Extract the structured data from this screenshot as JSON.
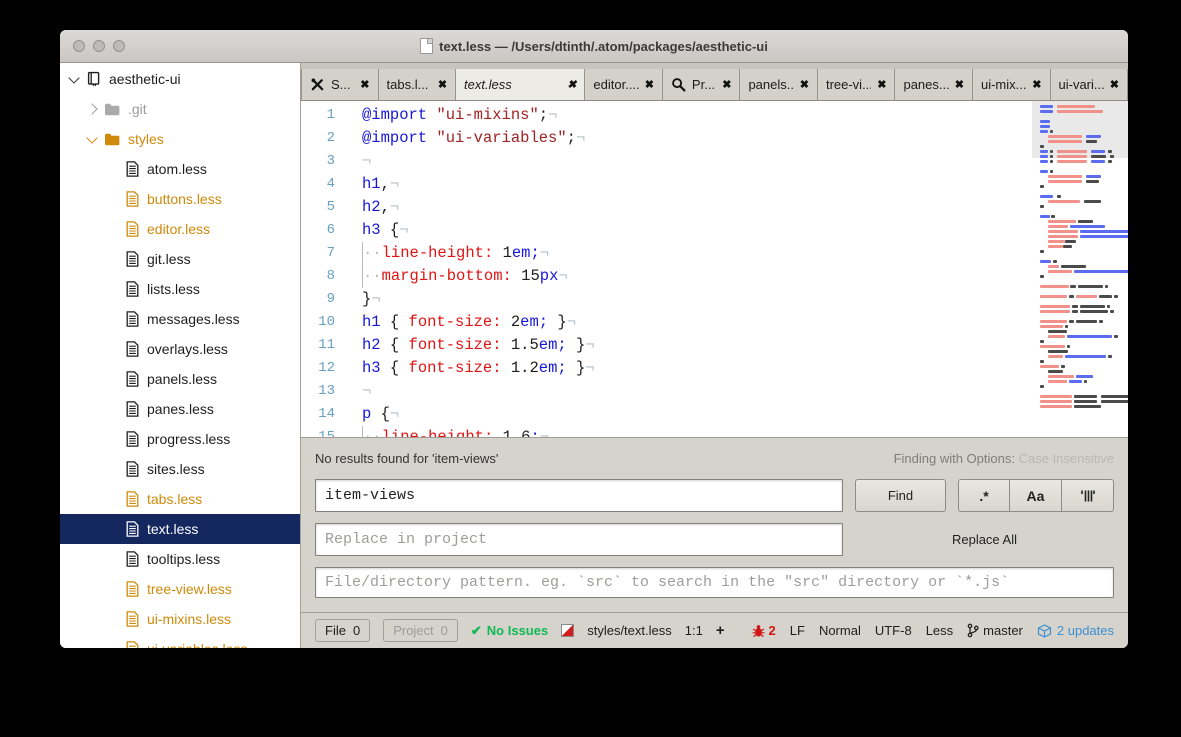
{
  "window": {
    "title": "text.less — /Users/dtinth/.atom/packages/aesthetic-ui"
  },
  "tree": {
    "items": [
      {
        "label": "aesthetic-ui",
        "icon": "repo-icon",
        "chevron": "down",
        "state": "default",
        "indent": 0
      },
      {
        "label": ".git",
        "icon": "folder-icon",
        "chevron": "right",
        "state": "ignored",
        "indent": 1
      },
      {
        "label": "styles",
        "icon": "folder-icon",
        "chevron": "down",
        "state": "modified",
        "indent": 1
      },
      {
        "label": "atom.less",
        "icon": "file-icon",
        "state": "default",
        "indent": 2
      },
      {
        "label": "buttons.less",
        "icon": "file-icon",
        "state": "modified",
        "indent": 2
      },
      {
        "label": "editor.less",
        "icon": "file-icon",
        "state": "modified",
        "indent": 2
      },
      {
        "label": "git.less",
        "icon": "file-icon",
        "state": "default",
        "indent": 2
      },
      {
        "label": "lists.less",
        "icon": "file-icon",
        "state": "default",
        "indent": 2
      },
      {
        "label": "messages.less",
        "icon": "file-icon",
        "state": "default",
        "indent": 2
      },
      {
        "label": "overlays.less",
        "icon": "file-icon",
        "state": "default",
        "indent": 2
      },
      {
        "label": "panels.less",
        "icon": "file-icon",
        "state": "default",
        "indent": 2
      },
      {
        "label": "panes.less",
        "icon": "file-icon",
        "state": "default",
        "indent": 2
      },
      {
        "label": "progress.less",
        "icon": "file-icon",
        "state": "default",
        "indent": 2
      },
      {
        "label": "sites.less",
        "icon": "file-icon",
        "state": "default",
        "indent": 2
      },
      {
        "label": "tabs.less",
        "icon": "file-icon",
        "state": "modified",
        "indent": 2
      },
      {
        "label": "text.less",
        "icon": "file-icon",
        "state": "selected",
        "indent": 2
      },
      {
        "label": "tooltips.less",
        "icon": "file-icon",
        "state": "default",
        "indent": 2
      },
      {
        "label": "tree-view.less",
        "icon": "file-icon",
        "state": "modified",
        "indent": 2
      },
      {
        "label": "ui-mixins.less",
        "icon": "file-icon",
        "state": "modified",
        "indent": 2
      },
      {
        "label": "ui-variables.less",
        "icon": "file-icon",
        "state": "modified",
        "indent": 2
      }
    ]
  },
  "tabs": [
    {
      "label": "S...",
      "icon": "tools-icon",
      "close": "✖"
    },
    {
      "label": "tabs.l...",
      "close": "✖"
    },
    {
      "label": "text.less",
      "active": true,
      "close": "✖"
    },
    {
      "label": "editor....",
      "close": "✖"
    },
    {
      "label": "Pr...",
      "icon": "search-icon",
      "close": "✖"
    },
    {
      "label": "panels...",
      "close": "✖"
    },
    {
      "label": "tree-vi...",
      "close": "✖"
    },
    {
      "label": "panes...",
      "close": "✖"
    },
    {
      "label": "ui-mix...",
      "close": "✖"
    },
    {
      "label": "ui-vari...",
      "close": "✖"
    }
  ],
  "editor": {
    "lines": [
      {
        "n": "1",
        "g": false,
        "s": [
          [
            "@import",
            "kw"
          ],
          [
            " ",
            "pl"
          ],
          [
            "\"ui-mixins\"",
            "str"
          ],
          [
            ";",
            "pl"
          ],
          [
            "¬",
            "inv"
          ]
        ]
      },
      {
        "n": "2",
        "g": false,
        "s": [
          [
            "@import",
            "kw"
          ],
          [
            " ",
            "pl"
          ],
          [
            "\"ui-variables\"",
            "str"
          ],
          [
            ";",
            "pl"
          ],
          [
            "¬",
            "inv"
          ]
        ]
      },
      {
        "n": "3",
        "g": false,
        "s": [
          [
            "¬",
            "inv"
          ]
        ]
      },
      {
        "n": "4",
        "g": false,
        "s": [
          [
            "h1",
            "kw"
          ],
          [
            ",",
            "pl"
          ],
          [
            "¬",
            "inv"
          ]
        ]
      },
      {
        "n": "5",
        "g": false,
        "s": [
          [
            "h2",
            "kw"
          ],
          [
            ",",
            "pl"
          ],
          [
            "¬",
            "inv"
          ]
        ]
      },
      {
        "n": "6",
        "g": false,
        "s": [
          [
            "h3",
            "kw"
          ],
          [
            " {",
            "pl"
          ],
          [
            "¬",
            "inv"
          ]
        ]
      },
      {
        "n": "7",
        "g": true,
        "s": [
          [
            "··",
            "inv"
          ],
          [
            "line-height",
            "prop"
          ],
          [
            ":",
            "prop"
          ],
          [
            " ",
            "pl"
          ],
          [
            "1",
            "pl"
          ],
          [
            "em;",
            "kw"
          ],
          [
            "¬",
            "inv"
          ]
        ]
      },
      {
        "n": "8",
        "g": true,
        "s": [
          [
            "··",
            "inv"
          ],
          [
            "margin-bottom",
            "prop"
          ],
          [
            ":",
            "prop"
          ],
          [
            " ",
            "pl"
          ],
          [
            "15",
            "pl"
          ],
          [
            "px",
            "kw"
          ],
          [
            "¬",
            "inv"
          ]
        ]
      },
      {
        "n": "9",
        "g": false,
        "s": [
          [
            "}",
            "pl"
          ],
          [
            "¬",
            "inv"
          ]
        ]
      },
      {
        "n": "10",
        "g": false,
        "s": [
          [
            "h1",
            "kw"
          ],
          [
            " { ",
            "pl"
          ],
          [
            "font-size",
            "prop"
          ],
          [
            ":",
            "prop"
          ],
          [
            " ",
            "pl"
          ],
          [
            "2",
            "pl"
          ],
          [
            "em;",
            "kw"
          ],
          [
            " }",
            "pl"
          ],
          [
            "¬",
            "inv"
          ]
        ]
      },
      {
        "n": "11",
        "g": false,
        "s": [
          [
            "h2",
            "kw"
          ],
          [
            " { ",
            "pl"
          ],
          [
            "font-size",
            "prop"
          ],
          [
            ":",
            "prop"
          ],
          [
            " ",
            "pl"
          ],
          [
            "1.5",
            "pl"
          ],
          [
            "em;",
            "kw"
          ],
          [
            " }",
            "pl"
          ],
          [
            "¬",
            "inv"
          ]
        ]
      },
      {
        "n": "12",
        "g": false,
        "s": [
          [
            "h3",
            "kw"
          ],
          [
            " { ",
            "pl"
          ],
          [
            "font-size",
            "prop"
          ],
          [
            ":",
            "prop"
          ],
          [
            " ",
            "pl"
          ],
          [
            "1.2",
            "pl"
          ],
          [
            "em;",
            "kw"
          ],
          [
            " }",
            "pl"
          ],
          [
            "¬",
            "inv"
          ]
        ]
      },
      {
        "n": "13",
        "g": false,
        "s": [
          [
            "¬",
            "inv"
          ]
        ]
      },
      {
        "n": "14",
        "g": false,
        "s": [
          [
            "p",
            "kw"
          ],
          [
            " {",
            "pl"
          ],
          [
            "¬",
            "inv"
          ]
        ]
      },
      {
        "n": "15",
        "g": true,
        "s": [
          [
            "··",
            "inv"
          ],
          [
            "line-height",
            "prop"
          ],
          [
            ":",
            "prop"
          ],
          [
            " ",
            "pl"
          ],
          [
            "1.6",
            "pl"
          ],
          [
            ";",
            "kw"
          ],
          [
            "¬",
            "inv"
          ]
        ]
      }
    ]
  },
  "minimap": {
    "colors": {
      "r": "#f2908a",
      "b": "#5b6cf0",
      "d": "#4b4b4b"
    },
    "rows": [
      [
        [
          0,
          7,
          "b"
        ],
        [
          9,
          20,
          "r"
        ]
      ],
      [
        [
          0,
          7,
          "b"
        ],
        [
          9,
          24,
          "r"
        ]
      ],
      [],
      [
        [
          0,
          5,
          "b"
        ]
      ],
      [
        [
          0,
          5,
          "b"
        ]
      ],
      [
        [
          0,
          4,
          "b"
        ],
        [
          5,
          2,
          "d"
        ]
      ],
      [
        [
          4,
          18,
          "r"
        ],
        [
          24,
          8,
          "b"
        ]
      ],
      [
        [
          4,
          18,
          "r"
        ],
        [
          24,
          6,
          "d"
        ]
      ],
      [
        [
          0,
          2,
          "d"
        ]
      ],
      [
        [
          0,
          4,
          "b"
        ],
        [
          5,
          2,
          "d"
        ],
        [
          9,
          16,
          "r"
        ],
        [
          27,
          7,
          "b"
        ],
        [
          36,
          2,
          "d"
        ]
      ],
      [
        [
          0,
          4,
          "b"
        ],
        [
          5,
          2,
          "d"
        ],
        [
          9,
          16,
          "r"
        ],
        [
          27,
          8,
          "d"
        ],
        [
          37,
          2,
          "d"
        ]
      ],
      [
        [
          0,
          4,
          "b"
        ],
        [
          5,
          2,
          "d"
        ],
        [
          9,
          16,
          "r"
        ],
        [
          27,
          7,
          "b"
        ],
        [
          36,
          2,
          "d"
        ]
      ],
      [],
      [
        [
          0,
          4,
          "b"
        ],
        [
          5,
          2,
          "d"
        ]
      ],
      [
        [
          4,
          18,
          "r"
        ],
        [
          24,
          8,
          "b"
        ]
      ],
      [
        [
          4,
          18,
          "r"
        ],
        [
          24,
          7,
          "d"
        ]
      ],
      [
        [
          0,
          2,
          "d"
        ]
      ],
      [],
      [
        [
          0,
          7,
          "b"
        ],
        [
          9,
          2,
          "d"
        ]
      ],
      [
        [
          4,
          17,
          "r"
        ],
        [
          23,
          9,
          "d"
        ]
      ],
      [
        [
          0,
          2,
          "d"
        ]
      ],
      [],
      [
        [
          0,
          5,
          "b"
        ],
        [
          6,
          2,
          "d"
        ]
      ],
      [
        [
          4,
          15,
          "r"
        ],
        [
          20,
          8,
          "d"
        ]
      ],
      [
        [
          4,
          11,
          "r"
        ],
        [
          16,
          18,
          "b"
        ]
      ],
      [
        [
          4,
          16,
          "r"
        ],
        [
          21,
          38,
          "b"
        ]
      ],
      [
        [
          4,
          16,
          "r"
        ],
        [
          21,
          34,
          "b"
        ]
      ],
      [
        [
          4,
          9,
          "r"
        ],
        [
          13,
          6,
          "d"
        ]
      ],
      [
        [
          4,
          8,
          "r"
        ],
        [
          12,
          5,
          "d"
        ]
      ],
      [
        [
          0,
          2,
          "d"
        ]
      ],
      [],
      [
        [
          0,
          6,
          "b"
        ],
        [
          7,
          2,
          "d"
        ]
      ],
      [
        [
          4,
          6,
          "r"
        ],
        [
          11,
          13,
          "d"
        ]
      ],
      [
        [
          4,
          13,
          "r"
        ],
        [
          18,
          30,
          "b"
        ]
      ],
      [
        [
          0,
          2,
          "d"
        ]
      ],
      [],
      [
        [
          0,
          15,
          "r"
        ],
        [
          16,
          3,
          "d"
        ],
        [
          20,
          13,
          "d"
        ],
        [
          34,
          2,
          "d"
        ]
      ],
      [],
      [
        [
          0,
          14,
          "r"
        ],
        [
          15,
          3,
          "d"
        ],
        [
          19,
          11,
          "r"
        ],
        [
          31,
          7,
          "d"
        ],
        [
          39,
          2,
          "d"
        ]
      ],
      [],
      [
        [
          0,
          16,
          "r"
        ],
        [
          17,
          3,
          "d"
        ],
        [
          21,
          13,
          "d"
        ],
        [
          35,
          2,
          "d"
        ]
      ],
      [
        [
          0,
          16,
          "r"
        ],
        [
          17,
          3,
          "d"
        ],
        [
          21,
          15,
          "d"
        ],
        [
          37,
          2,
          "d"
        ]
      ],
      [],
      [
        [
          0,
          14,
          "r"
        ],
        [
          15,
          3,
          "d"
        ],
        [
          19,
          11,
          "d"
        ],
        [
          31,
          2,
          "d"
        ]
      ],
      [
        [
          0,
          12,
          "r"
        ],
        [
          13,
          2,
          "d"
        ]
      ],
      [
        [
          4,
          10,
          "d"
        ]
      ],
      [
        [
          4,
          9,
          "r"
        ],
        [
          14,
          24,
          "b"
        ],
        [
          39,
          2,
          "d"
        ]
      ],
      [
        [
          0,
          2,
          "d"
        ]
      ],
      [
        [
          0,
          13,
          "r"
        ],
        [
          14,
          2,
          "d"
        ]
      ],
      [
        [
          4,
          11,
          "d"
        ]
      ],
      [
        [
          4,
          8,
          "r"
        ],
        [
          13,
          22,
          "b"
        ],
        [
          36,
          2,
          "d"
        ]
      ],
      [
        [
          0,
          2,
          "d"
        ]
      ],
      [
        [
          0,
          10,
          "r"
        ],
        [
          11,
          2,
          "d"
        ]
      ],
      [
        [
          4,
          8,
          "d"
        ]
      ],
      [
        [
          4,
          14,
          "r"
        ],
        [
          19,
          9,
          "b"
        ]
      ],
      [
        [
          4,
          10,
          "r"
        ],
        [
          15,
          7,
          "b"
        ],
        [
          23,
          2,
          "d"
        ]
      ],
      [
        [
          0,
          2,
          "d"
        ]
      ],
      [],
      [
        [
          0,
          17,
          "r"
        ],
        [
          18,
          12,
          "d"
        ],
        [
          32,
          26,
          "d"
        ]
      ],
      [
        [
          0,
          17,
          "r"
        ],
        [
          18,
          12,
          "d"
        ],
        [
          32,
          30,
          "d"
        ]
      ],
      [
        [
          0,
          17,
          "r"
        ],
        [
          18,
          14,
          "d"
        ]
      ]
    ]
  },
  "find": {
    "results": "No results found for 'item-views'",
    "options_label": "Finding with Options:",
    "options_value": "Case Insensitive",
    "find_value": "item-views",
    "find_button": "Find",
    "regex_button": ".*",
    "case_button": "Aa",
    "replace_placeholder": "Replace in project",
    "replace_all": "Replace All",
    "path_placeholder": "File/directory pattern. eg. `src` to search in the \"src\" directory or `*.js`"
  },
  "status": {
    "file_label": "File",
    "file_count": "0",
    "project_label": "Project",
    "project_count": "0",
    "no_issues": "No Issues",
    "check": "✔",
    "path": "styles/text.less",
    "cursor": "1:1",
    "plus": "+",
    "bug_count": "2",
    "line_ending": "LF",
    "mode": "Normal",
    "encoding": "UTF-8",
    "grammar": "Less",
    "branch": "master",
    "updates": "2 updates"
  }
}
